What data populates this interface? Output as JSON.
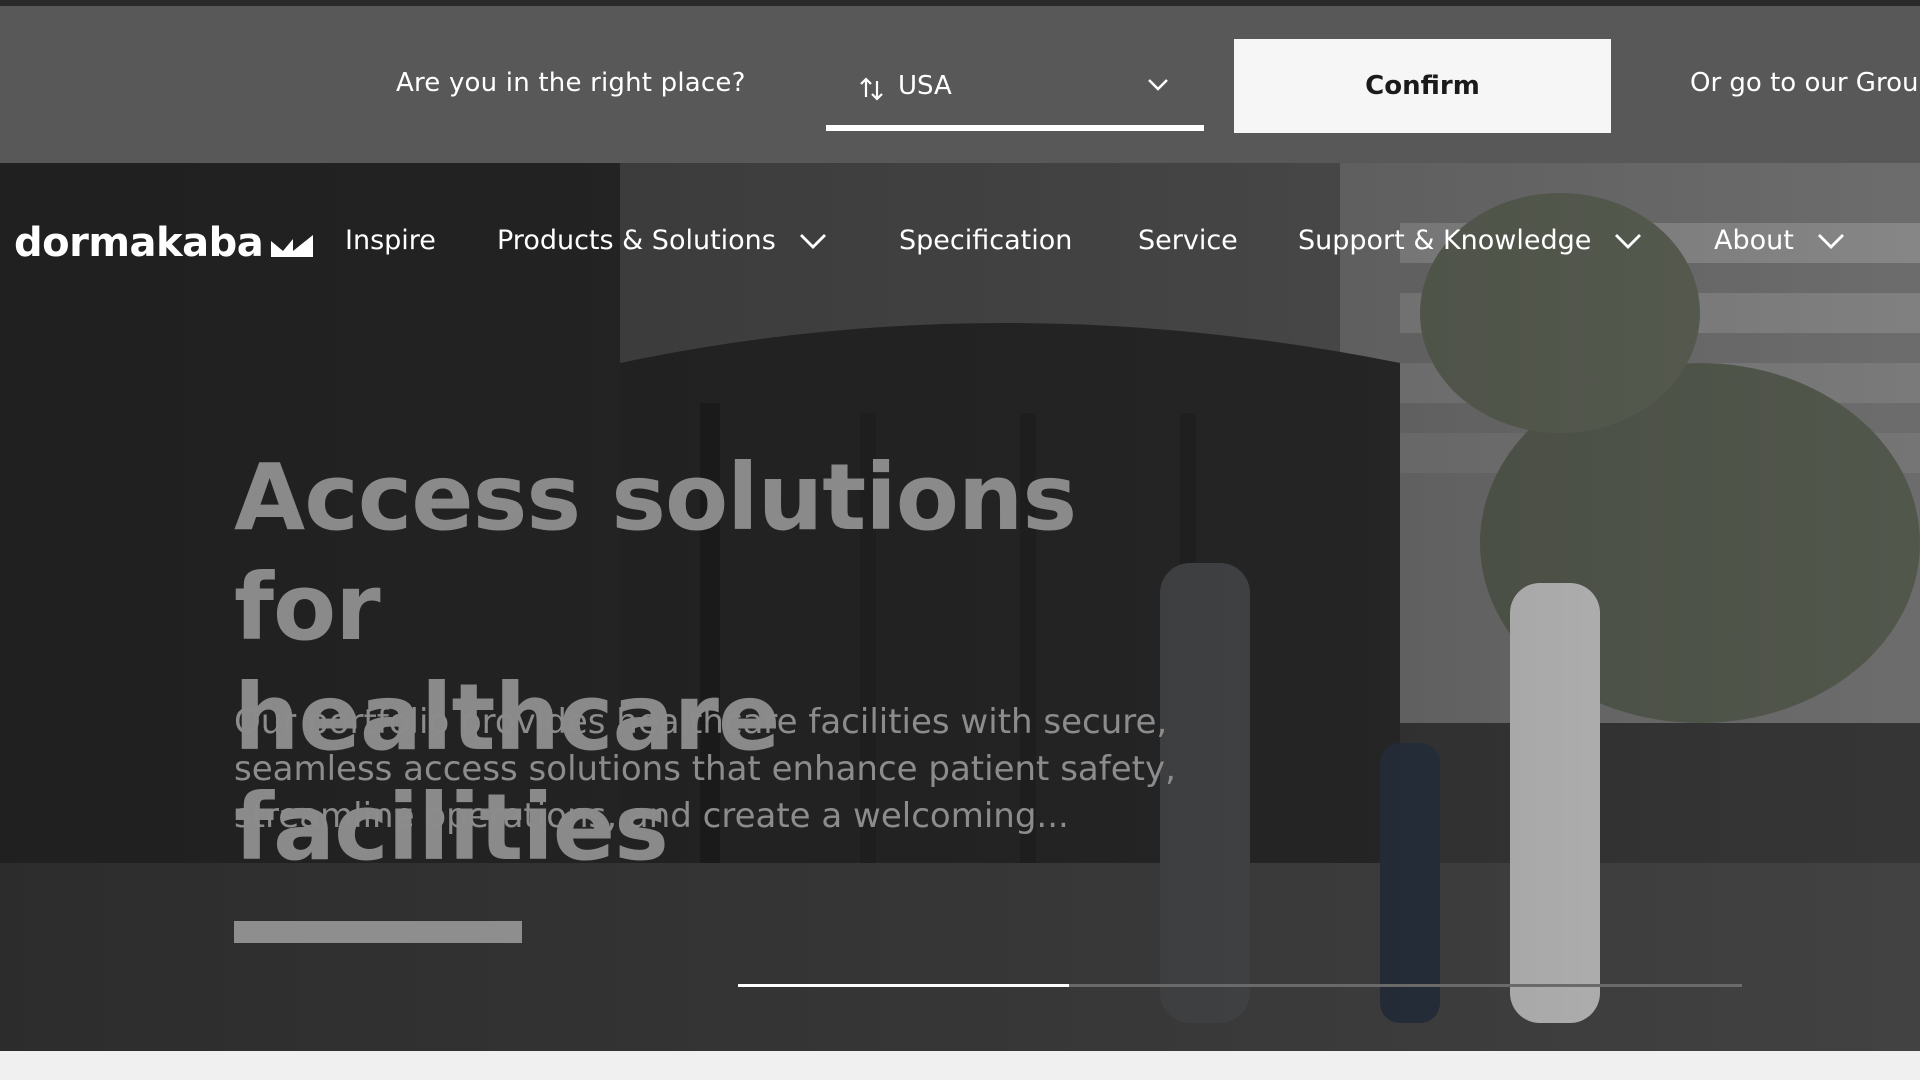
{
  "country_bar": {
    "question": "Are you in the right place?",
    "country_value": "USA",
    "confirm_label": "Confirm",
    "group_link": "Or go to our Grou"
  },
  "nav": {
    "logo_text": "dormakaba",
    "items": [
      {
        "label": "Inspire",
        "has_dropdown": false
      },
      {
        "label": "Products & Solutions",
        "has_dropdown": true
      },
      {
        "label": "Specification",
        "has_dropdown": false
      },
      {
        "label": "Service",
        "has_dropdown": false
      },
      {
        "label": "Support & Knowledge",
        "has_dropdown": true
      },
      {
        "label": "About",
        "has_dropdown": true
      }
    ]
  },
  "hero": {
    "title_line1": "Access solutions for",
    "title_line2": "healthcare facilities",
    "text_line1": "Our portfolio provides healthcare facilities with secure,",
    "text_line2": "seamless access solutions that enhance patient safety,",
    "text_line3": "streamline operations, and create a welcoming...",
    "cta_label": "",
    "slide_progress": 0.33
  },
  "colors": {
    "country_bar_bg": "#585858",
    "confirm_bg": "#f6f6f6",
    "hero_title": "#8a8a8a",
    "hero_text": "#8c8c8c"
  }
}
